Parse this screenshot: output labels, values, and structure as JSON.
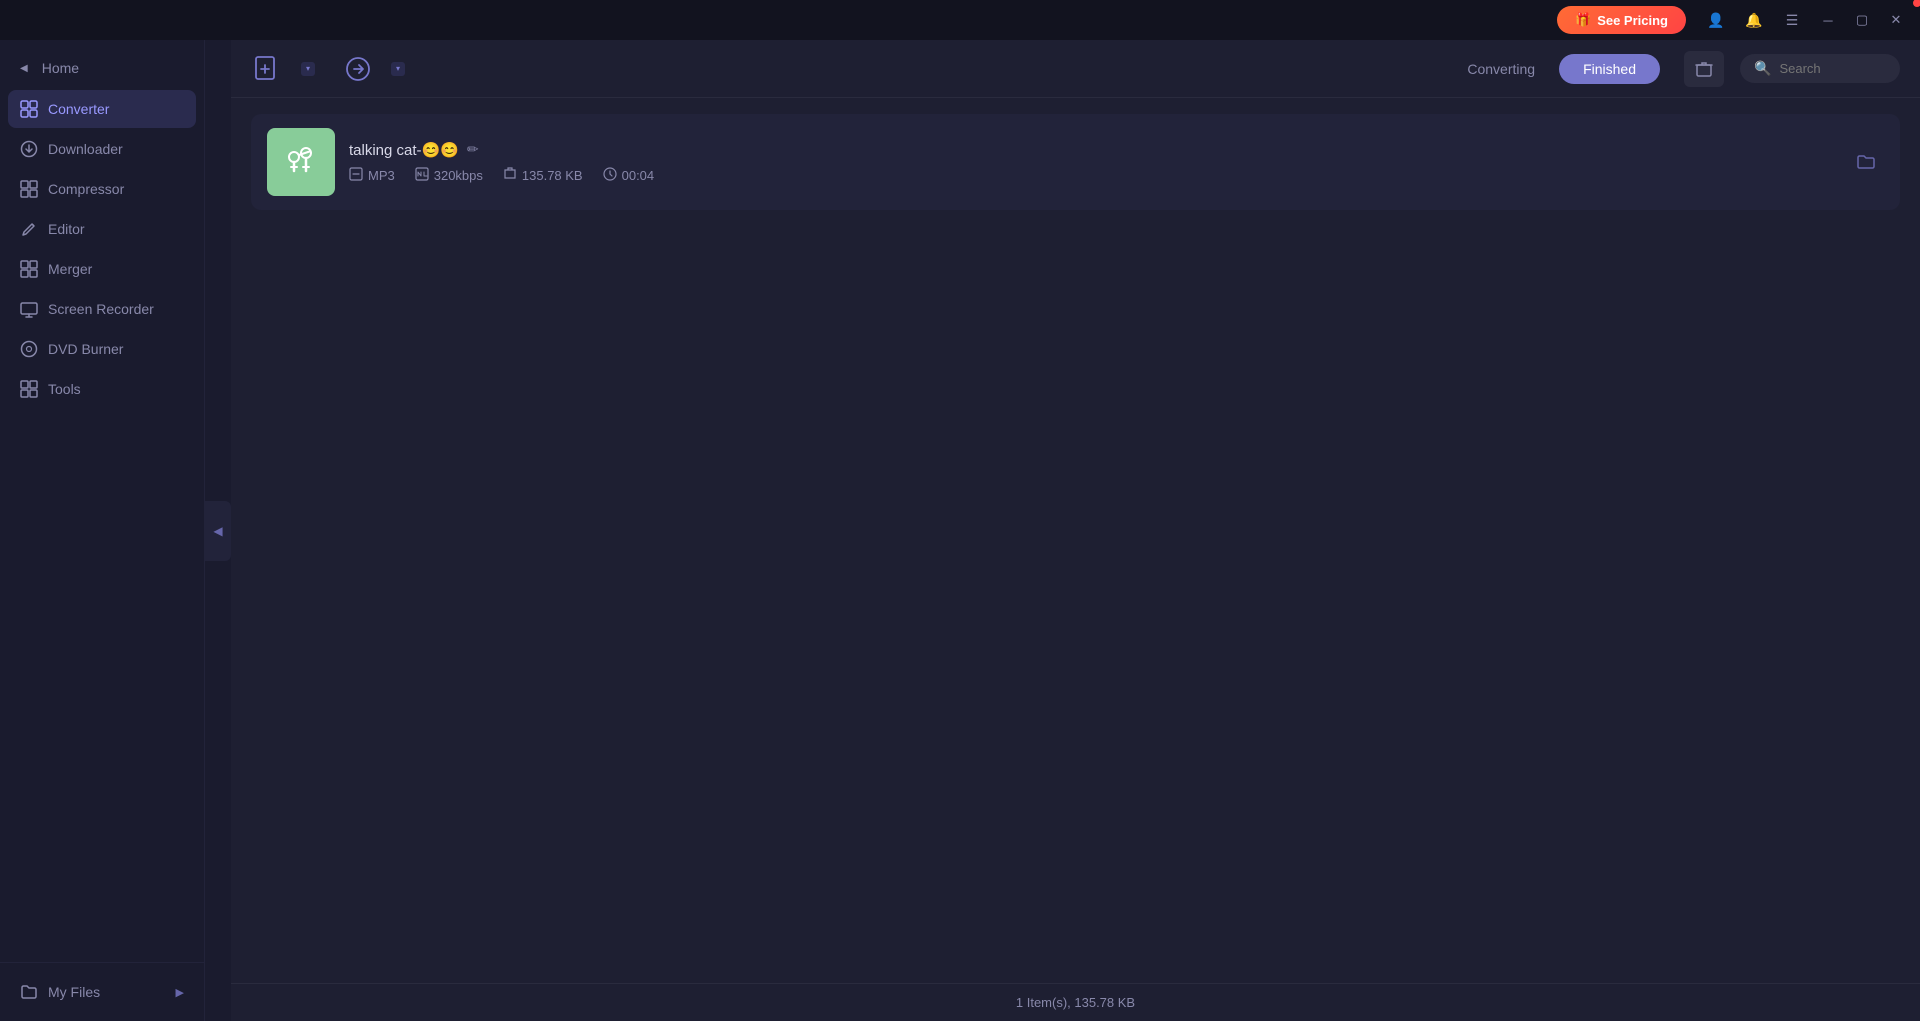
{
  "titlebar": {
    "see_pricing_label": "See Pricing",
    "see_pricing_icon": "🎁"
  },
  "sidebar": {
    "home_label": "Home",
    "items": [
      {
        "id": "converter",
        "label": "Converter",
        "icon": "⬜",
        "active": true
      },
      {
        "id": "downloader",
        "label": "Downloader",
        "icon": "⬇"
      },
      {
        "id": "compressor",
        "label": "Compressor",
        "icon": "⊞"
      },
      {
        "id": "editor",
        "label": "Editor",
        "icon": "✂"
      },
      {
        "id": "merger",
        "label": "Merger",
        "icon": "⊞"
      },
      {
        "id": "screen-recorder",
        "label": "Screen Recorder",
        "icon": "⊞"
      },
      {
        "id": "dvd-burner",
        "label": "DVD Burner",
        "icon": "⊞"
      },
      {
        "id": "tools",
        "label": "Tools",
        "icon": "⊞"
      }
    ],
    "my_files_label": "My Files"
  },
  "header": {
    "converting_tab": "Converting",
    "finished_tab": "Finished",
    "active_tab": "finished",
    "search_placeholder": "Search"
  },
  "file_list": {
    "items": [
      {
        "name": "talking cat-😊😊",
        "format": "MP3",
        "bitrate": "320kbps",
        "size": "135.78 KB",
        "duration": "00:04"
      }
    ]
  },
  "status_bar": {
    "text": "1 Item(s), 135.78 KB"
  }
}
